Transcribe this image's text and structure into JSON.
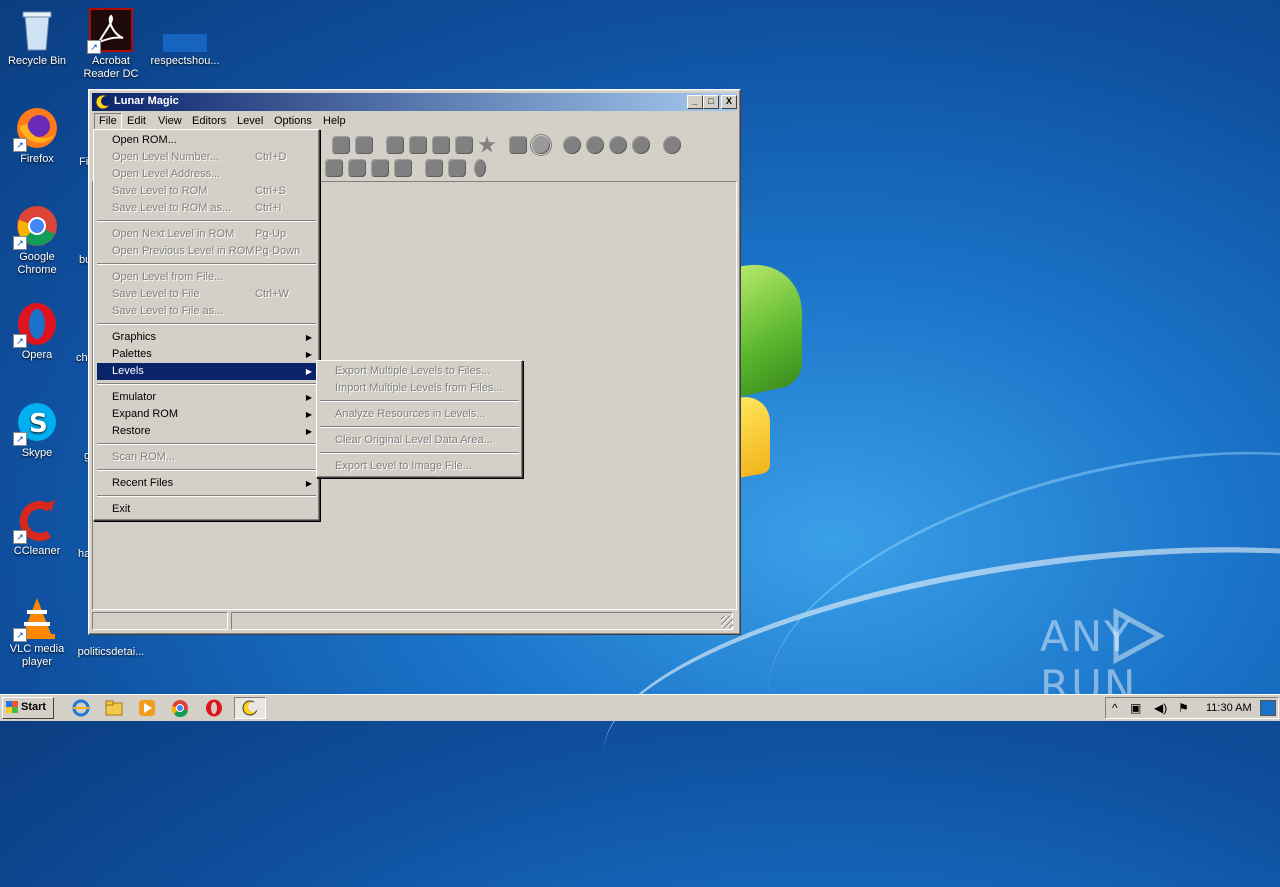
{
  "desktop": {
    "icons": [
      {
        "label": "Recycle Bin"
      },
      {
        "label": "Acrobat Reader DC"
      },
      {
        "label": "respectshou..."
      },
      {
        "label": "Firefox"
      },
      {
        "label": "Google Chrome"
      },
      {
        "label": "Opera"
      },
      {
        "label": "Skype"
      },
      {
        "label": "CCleaner"
      },
      {
        "label": "VLC media player"
      },
      {
        "label": "politicsdetai..."
      }
    ],
    "partial_labels": [
      "Fi",
      "bu",
      "ch",
      "g",
      "ha"
    ],
    "watermark": "ANY RUN"
  },
  "window": {
    "title": "Lunar Magic",
    "controls": {
      "minimize": "_",
      "maximize": "□",
      "close": "X"
    },
    "menubar": [
      "File",
      "Edit",
      "View",
      "Editors",
      "Level",
      "Options",
      "Help"
    ]
  },
  "file_menu": {
    "items": [
      {
        "label": "Open ROM...",
        "shortcut": "",
        "enabled": true
      },
      {
        "label": "Open Level Number...",
        "shortcut": "Ctrl+D",
        "enabled": false
      },
      {
        "label": "Open Level Address...",
        "shortcut": "",
        "enabled": false
      },
      {
        "label": "Save Level to ROM",
        "shortcut": "Ctrl+S",
        "enabled": false
      },
      {
        "label": "Save Level to ROM as...",
        "shortcut": "Ctrl+I",
        "enabled": false
      },
      {
        "label": "Open Next Level in ROM",
        "shortcut": "Pg-Up",
        "enabled": false
      },
      {
        "label": "Open Previous Level in ROM",
        "shortcut": "Pg-Down",
        "enabled": false
      },
      {
        "label": "Open Level from File...",
        "shortcut": "",
        "enabled": false
      },
      {
        "label": "Save Level to File",
        "shortcut": "Ctrl+W",
        "enabled": false
      },
      {
        "label": "Save Level to File as...",
        "shortcut": "",
        "enabled": false
      },
      {
        "label": "Graphics",
        "shortcut": "",
        "enabled": true
      },
      {
        "label": "Palettes",
        "shortcut": "",
        "enabled": true
      },
      {
        "label": "Levels",
        "shortcut": "",
        "enabled": true
      },
      {
        "label": "Emulator",
        "shortcut": "",
        "enabled": true
      },
      {
        "label": "Expand ROM",
        "shortcut": "",
        "enabled": true
      },
      {
        "label": "Restore",
        "shortcut": "",
        "enabled": true
      },
      {
        "label": "Scan ROM...",
        "shortcut": "",
        "enabled": false
      },
      {
        "label": "Recent Files",
        "shortcut": "",
        "enabled": true
      },
      {
        "label": "Exit",
        "shortcut": "",
        "enabled": true
      }
    ],
    "submenu_arrow": "▶"
  },
  "levels_submenu": {
    "items": [
      {
        "label": "Export Multiple Levels to Files...",
        "enabled": false
      },
      {
        "label": "Import Multiple Levels from Files...",
        "enabled": false
      },
      {
        "label": "Analyze Resources in Levels...",
        "enabled": false
      },
      {
        "label": "Clear Original Level Data Area...",
        "enabled": false
      },
      {
        "label": "Export Level to Image File...",
        "enabled": false
      }
    ]
  },
  "taskbar": {
    "start_label": "Start",
    "clock": "11:30 AM",
    "tray_expand": "^"
  }
}
